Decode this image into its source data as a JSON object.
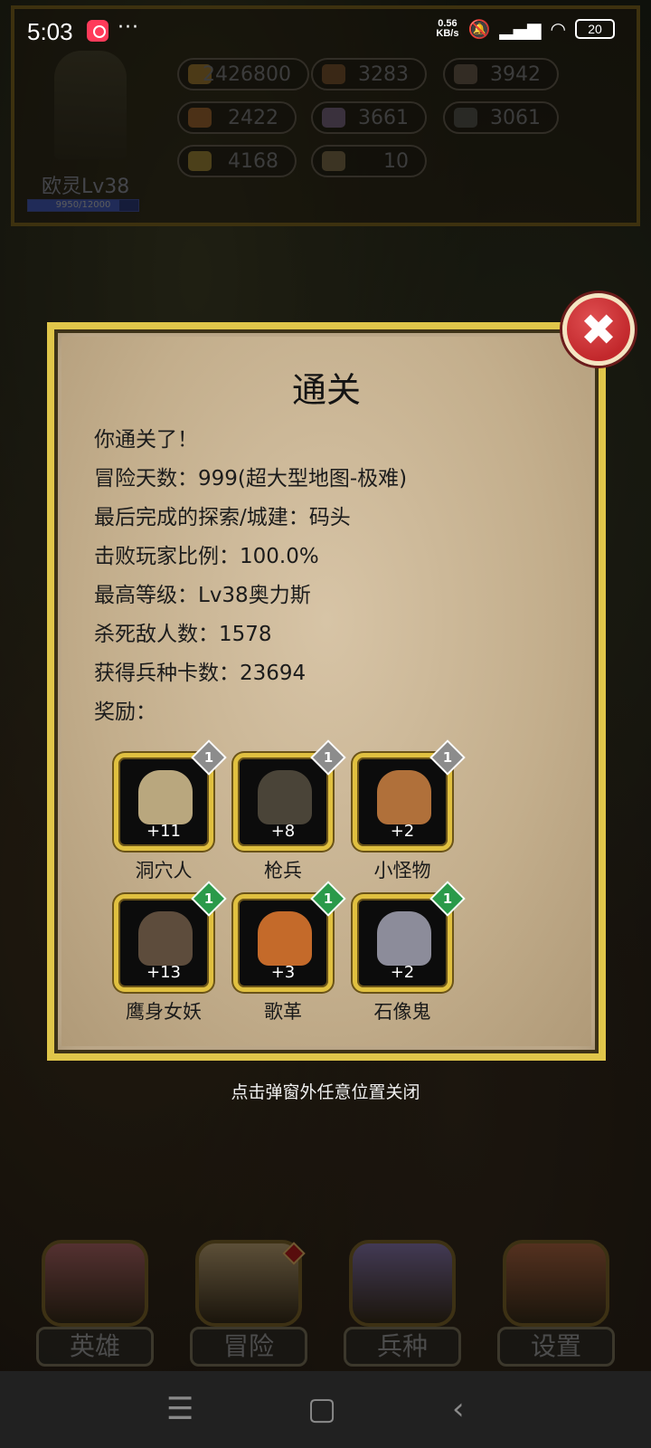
{
  "status_bar": {
    "time": "5:03",
    "more": "···",
    "net_speed_value": "0.56",
    "net_speed_unit": "KB/s",
    "battery": "20",
    "icons": [
      "app-notification-icon",
      "mute-icon",
      "hd-signal-icon",
      "wifi-icon",
      "battery-icon"
    ]
  },
  "hero": {
    "name": "欧灵Lv38",
    "xp_text": "9950/12000",
    "xp_fraction": 0.829
  },
  "resources": [
    {
      "name": "gold",
      "value": "2426800",
      "color": "#8a6a2a"
    },
    {
      "name": "wood",
      "value": "3283",
      "color": "#6b4a28"
    },
    {
      "name": "ore",
      "value": "3942",
      "color": "#5e5142"
    },
    {
      "name": "crystal",
      "value": "2422",
      "color": "#8a5a2a"
    },
    {
      "name": "gem",
      "value": "3661",
      "color": "#6a5a70"
    },
    {
      "name": "pot",
      "value": "3061",
      "color": "#4c4c44"
    },
    {
      "name": "sulfur",
      "value": "4168",
      "color": "#8a7530"
    },
    {
      "name": "scroll",
      "value": "10",
      "color": "#6e6040"
    }
  ],
  "dialog": {
    "title": "通关",
    "lines": [
      "你通关了！",
      "冒险天数：999(超大型地图-极难)",
      "最后完成的探索/城建：码头",
      "击败玩家比例：100.0%",
      "最高等级：Lv38奥力斯",
      "杀死敌人数：1578",
      "获得兵种卡数：23694",
      "奖励："
    ],
    "rewards": [
      {
        "name": "洞穴人",
        "count": "+11",
        "level": "1",
        "badge_color": "#8c8c8c",
        "creature_color": "#b9a77e"
      },
      {
        "name": "枪兵",
        "count": "+8",
        "level": "1",
        "badge_color": "#8c8c8c",
        "creature_color": "#4a4438"
      },
      {
        "name": "小怪物",
        "count": "+2",
        "level": "1",
        "badge_color": "#8c8c8c",
        "creature_color": "#b0703a"
      },
      {
        "name": "鹰身女妖",
        "count": "+13",
        "level": "1",
        "badge_color": "#2a9a4a",
        "creature_color": "#5d4c3c"
      },
      {
        "name": "歌革",
        "count": "+3",
        "level": "1",
        "badge_color": "#2a9a4a",
        "creature_color": "#c46a2a"
      },
      {
        "name": "石像鬼",
        "count": "+2",
        "level": "1",
        "badge_color": "#2a9a4a",
        "creature_color": "#8c8c9a"
      }
    ],
    "close_symbol": "✖"
  },
  "hint": "点击弹窗外任意位置关闭",
  "bottom_nav": [
    {
      "label": "英雄",
      "icon": "flag-icon",
      "color": "#9a5a5a"
    },
    {
      "label": "冒险",
      "icon": "scroll-map-icon",
      "color": "#a89066"
    },
    {
      "label": "兵种",
      "icon": "wings-icon",
      "color": "#7a6a9a"
    },
    {
      "label": "设置",
      "icon": "gear-icon",
      "color": "#9a5a3a"
    }
  ],
  "system_nav": [
    "menu-icon",
    "home-icon",
    "back-icon"
  ]
}
